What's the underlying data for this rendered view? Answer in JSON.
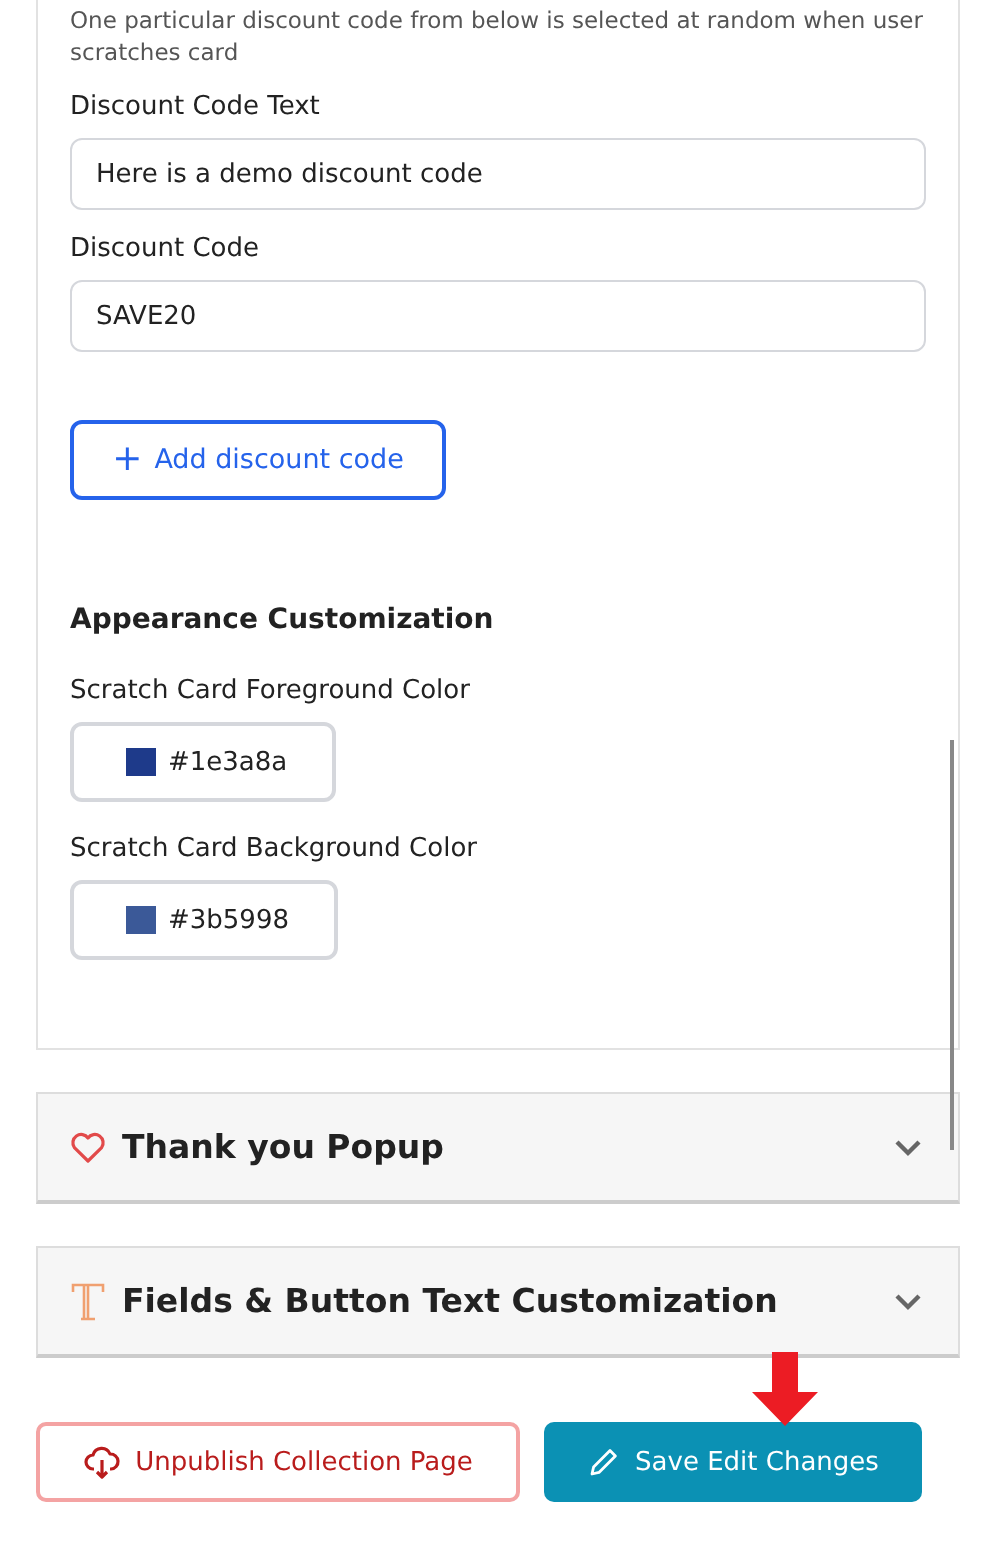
{
  "discount_section": {
    "description": "One particular discount code from below is selected at random when user scratches card",
    "fields": [
      {
        "label": "Discount Code Text",
        "value": "Here is a demo discount code"
      },
      {
        "label": "Discount Code",
        "value": "SAVE20"
      }
    ],
    "add_button": {
      "icon": "+",
      "label": "Add discount code"
    }
  },
  "appearance": {
    "heading": "Appearance Customization",
    "colors": [
      {
        "label": "Scratch Card Foreground Color",
        "value": "#1e3a8a",
        "color": "#1e3a8a"
      },
      {
        "label": "Scratch Card Background Color",
        "value": "#3b5998",
        "color": "#3b5998"
      }
    ]
  },
  "accordions": [
    {
      "kind": "heart",
      "title": "Thank you Popup",
      "expanded": false
    },
    {
      "kind": "text",
      "title": "Fields & Button Text Customization",
      "expanded": false
    }
  ],
  "actions": [
    {
      "kind": "outline",
      "label": "Unpublish Collection Page"
    },
    {
      "kind": "primary",
      "label": "Save Edit Changes"
    }
  ]
}
